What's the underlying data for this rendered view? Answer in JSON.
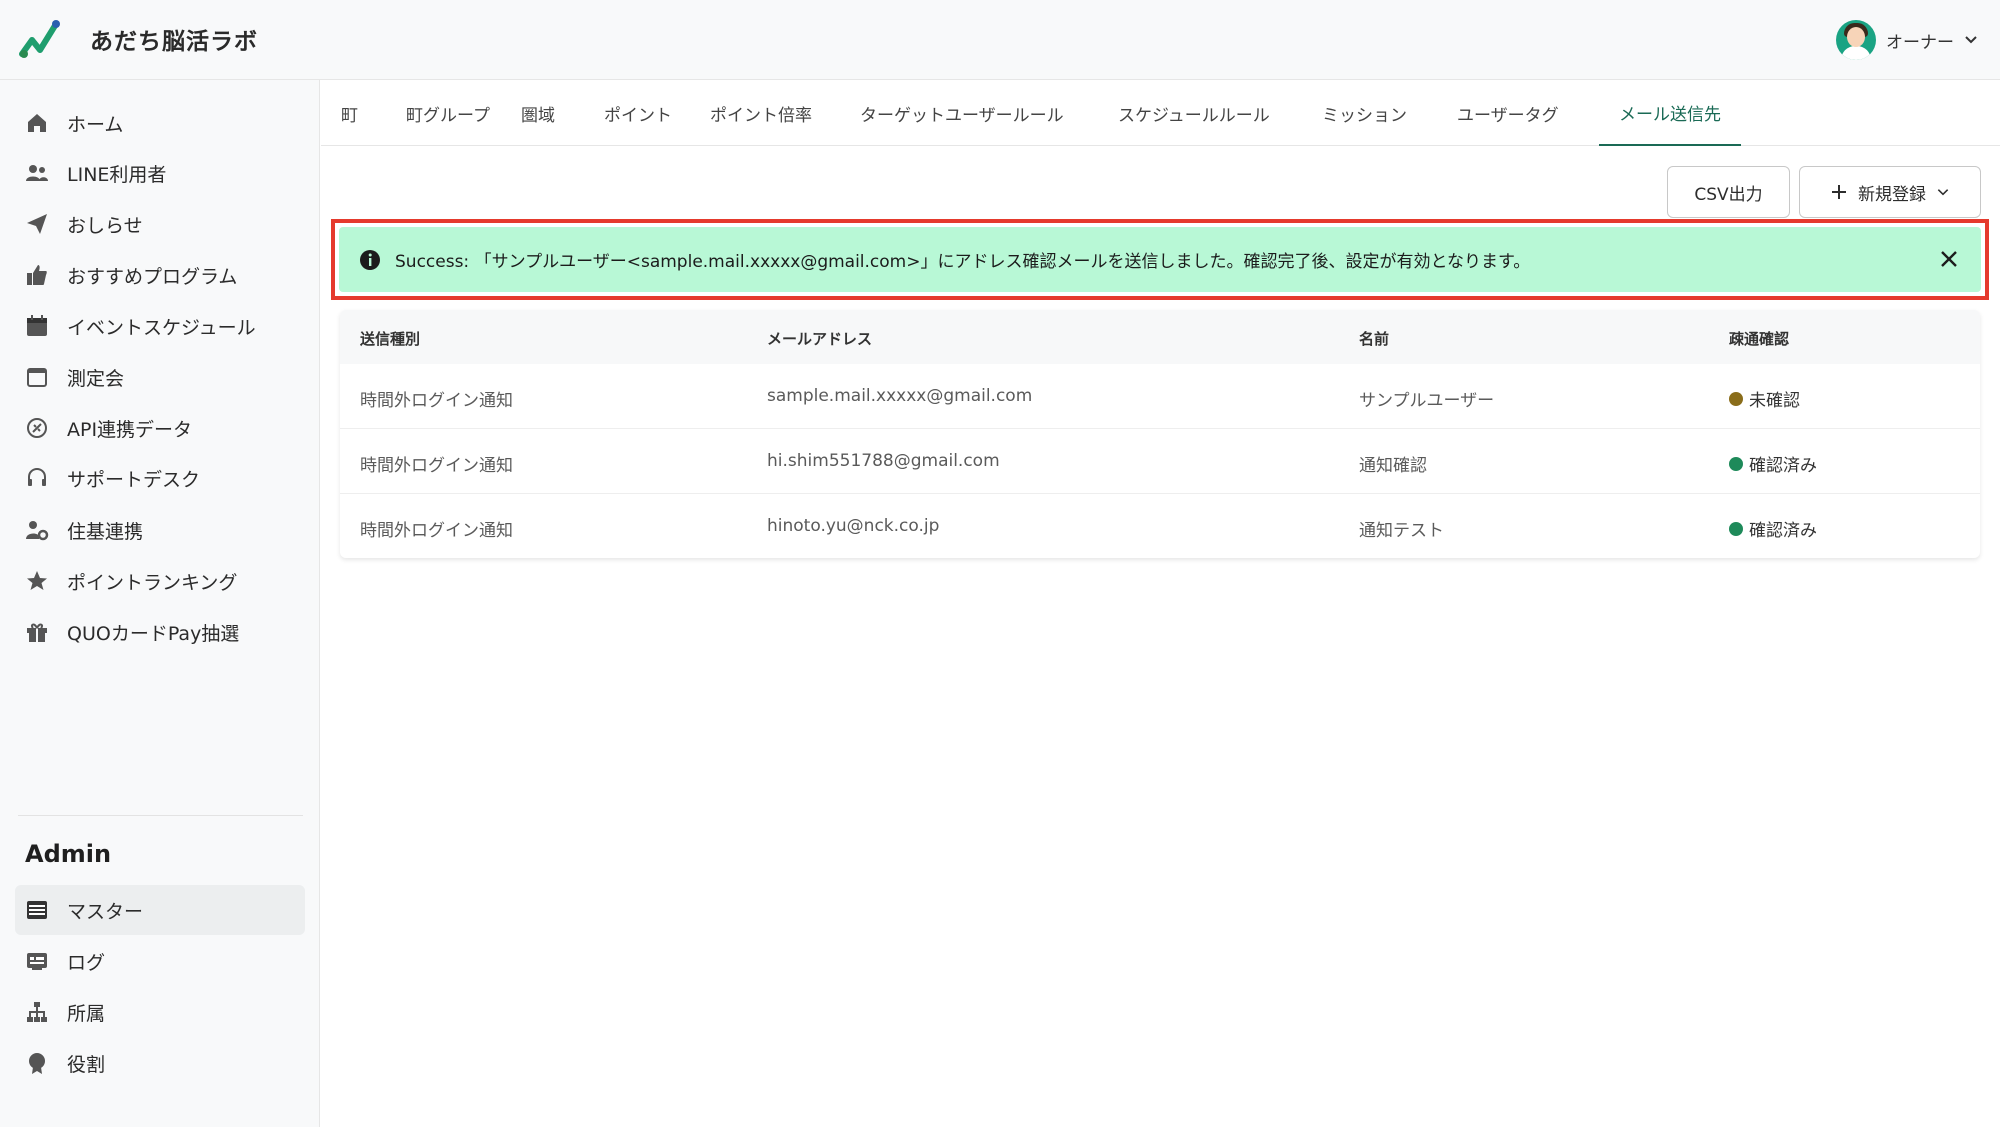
{
  "app": {
    "title": "あだち脳活ラボ"
  },
  "user": {
    "name": "オーナー"
  },
  "sidebar": {
    "items": [
      {
        "label": "ホーム",
        "icon": "home-icon"
      },
      {
        "label": "LINE利用者",
        "icon": "users-icon"
      },
      {
        "label": "おしらせ",
        "icon": "paper-plane-icon"
      },
      {
        "label": "おすすめプログラム",
        "icon": "thumbs-up-icon"
      },
      {
        "label": "イベントスケジュール",
        "icon": "calendar-icon"
      },
      {
        "label": "測定会",
        "icon": "calendar-blank-icon"
      },
      {
        "label": "API連携データ",
        "icon": "api-icon"
      },
      {
        "label": "サポートデスク",
        "icon": "headset-icon"
      },
      {
        "label": "住基連携",
        "icon": "user-gear-icon"
      },
      {
        "label": "ポイントランキング",
        "icon": "star-icon"
      },
      {
        "label": "QUOカードPay抽選",
        "icon": "gift-icon"
      }
    ],
    "admin_heading": "Admin",
    "admin_items": [
      {
        "label": "マスター",
        "icon": "server-icon"
      },
      {
        "label": "ログ",
        "icon": "log-icon"
      },
      {
        "label": "所属",
        "icon": "sitemap-icon"
      },
      {
        "label": "役割",
        "icon": "award-icon"
      }
    ]
  },
  "tabs": [
    "町",
    "町グループ",
    "圏域",
    "ポイント",
    "ポイント倍率",
    "ターゲットユーザールール",
    "スケジュールルール",
    "ミッション",
    "ユーザータグ",
    "メール送信先"
  ],
  "active_tab": "メール送信先",
  "toolbar": {
    "csv_label": "CSV出力",
    "new_label": "新規登録"
  },
  "alert": {
    "prefix": "Success:",
    "message": "「サンプルユーザー<sample.mail.xxxxx@gmail.com>」にアドレス確認メールを送信しました。確認完了後、設定が有効となります。"
  },
  "table": {
    "headers": [
      "送信種別",
      "メールアドレス",
      "名前",
      "疎通確認"
    ],
    "rows": [
      {
        "type": "時間外ログイン通知",
        "email": "sample.mail.xxxxx@gmail.com",
        "name": "サンプルユーザー",
        "status": "未確認",
        "status_color": "#8a6d1a"
      },
      {
        "type": "時間外ログイン通知",
        "email": "hi.shim551788@gmail.com",
        "name": "通知確認",
        "status": "確認済み",
        "status_color": "#1e8a5a"
      },
      {
        "type": "時間外ログイン通知",
        "email": "hinoto.yu@nck.co.jp",
        "name": "通知テスト",
        "status": "確認済み",
        "status_color": "#1e8a5a"
      }
    ]
  },
  "colors": {
    "accent": "#1a6a55",
    "alert_bg": "#b8f8d6",
    "highlight": "#e53a2d"
  }
}
